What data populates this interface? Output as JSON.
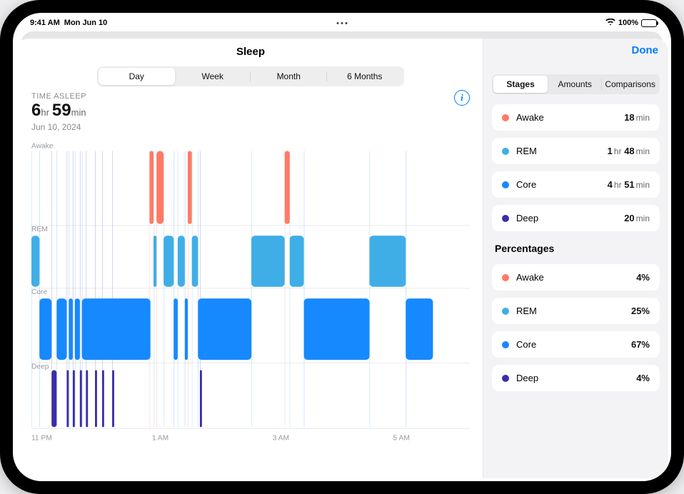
{
  "statusbar": {
    "time": "9:41 AM",
    "date": "Mon Jun 10",
    "battery_pct": "100%"
  },
  "nav": {
    "title": "Sleep",
    "done": "Done"
  },
  "seg": {
    "day": "Day",
    "week": "Week",
    "month": "Month",
    "six_months": "6 Months"
  },
  "header": {
    "label": "TIME ASLEEP",
    "hours": "6",
    "hr": "hr",
    "minutes": "59",
    "min": "min",
    "date": "Jun 10, 2024"
  },
  "chart": {
    "lane_awake": "Awake",
    "lane_rem": "REM",
    "lane_core": "Core",
    "lane_deep": "Deep",
    "x_11pm": "11 PM",
    "x_1am": "1 AM",
    "x_3am": "3 AM",
    "x_5am": "5 AM"
  },
  "side_seg": {
    "stages": "Stages",
    "amounts": "Amounts",
    "comparisons": "Comparisons"
  },
  "stages": {
    "awake_name": "Awake",
    "awake_val": "18",
    "awake_unit": "min",
    "rem_name": "REM",
    "rem_val_prefix": "1",
    "rem_hr": "hr",
    "rem_val": "48",
    "rem_unit": "min",
    "core_name": "Core",
    "core_val_prefix": "4",
    "core_hr": "hr",
    "core_val": "51",
    "core_unit": "min",
    "deep_name": "Deep",
    "deep_val": "20",
    "deep_unit": "min"
  },
  "percent": {
    "title": "Percentages",
    "awake_name": "Awake",
    "awake_val": "4%",
    "rem_name": "REM",
    "rem_val": "25%",
    "core_name": "Core",
    "core_val": "67%",
    "deep_name": "Deep",
    "deep_val": "4%"
  },
  "colors": {
    "awake": "#ff7a66",
    "rem": "#40aee6",
    "core": "#1789ff",
    "deep": "#3b2ea8"
  },
  "chart_data": {
    "type": "bar",
    "title": "Time Asleep",
    "total_hours": 6,
    "total_minutes": 59,
    "date": "Jun 10, 2024",
    "x_unit": "minutes_since_11PM",
    "x_range_minutes": [
      0,
      420
    ],
    "x_tick_labels": [
      "11 PM",
      "1 AM",
      "3 AM",
      "5 AM"
    ],
    "lanes": [
      "Awake",
      "REM",
      "Core",
      "Deep"
    ],
    "durations": [
      {
        "lane": "Awake",
        "minutes": 18
      },
      {
        "lane": "REM",
        "hours": 1,
        "minutes": 48
      },
      {
        "lane": "Core",
        "hours": 4,
        "minutes": 51
      },
      {
        "lane": "Deep",
        "minutes": 20
      }
    ],
    "percentages": {
      "Awake": 4,
      "REM": 25,
      "Core": 67,
      "Deep": 4
    },
    "series": [
      {
        "name": "Awake",
        "color": "#ff7a66",
        "segments": [
          {
            "start": 117,
            "end": 121
          },
          {
            "start": 124,
            "end": 131
          },
          {
            "start": 155,
            "end": 159
          },
          {
            "start": 251,
            "end": 256
          }
        ]
      },
      {
        "name": "REM",
        "color": "#40aee6",
        "segments": [
          {
            "start": 0,
            "end": 8
          },
          {
            "start": 121,
            "end": 124
          },
          {
            "start": 131,
            "end": 141
          },
          {
            "start": 145,
            "end": 152
          },
          {
            "start": 159,
            "end": 165
          },
          {
            "start": 218,
            "end": 251
          },
          {
            "start": 256,
            "end": 270
          },
          {
            "start": 335,
            "end": 371
          }
        ]
      },
      {
        "name": "Core",
        "color": "#1789ff",
        "segments": [
          {
            "start": 8,
            "end": 20
          },
          {
            "start": 25,
            "end": 35
          },
          {
            "start": 37,
            "end": 41
          },
          {
            "start": 43,
            "end": 48
          },
          {
            "start": 50,
            "end": 118
          },
          {
            "start": 141,
            "end": 145
          },
          {
            "start": 152,
            "end": 155
          },
          {
            "start": 165,
            "end": 218
          },
          {
            "start": 270,
            "end": 335
          },
          {
            "start": 371,
            "end": 398
          }
        ]
      },
      {
        "name": "Deep",
        "color": "#3b2ea8",
        "segments": [
          {
            "start": 20,
            "end": 25
          },
          {
            "start": 35,
            "end": 37
          },
          {
            "start": 41,
            "end": 43
          },
          {
            "start": 48,
            "end": 50
          },
          {
            "start": 54,
            "end": 56
          },
          {
            "start": 63,
            "end": 65
          },
          {
            "start": 70,
            "end": 72
          },
          {
            "start": 80,
            "end": 82
          },
          {
            "start": 167,
            "end": 169
          }
        ]
      }
    ]
  }
}
